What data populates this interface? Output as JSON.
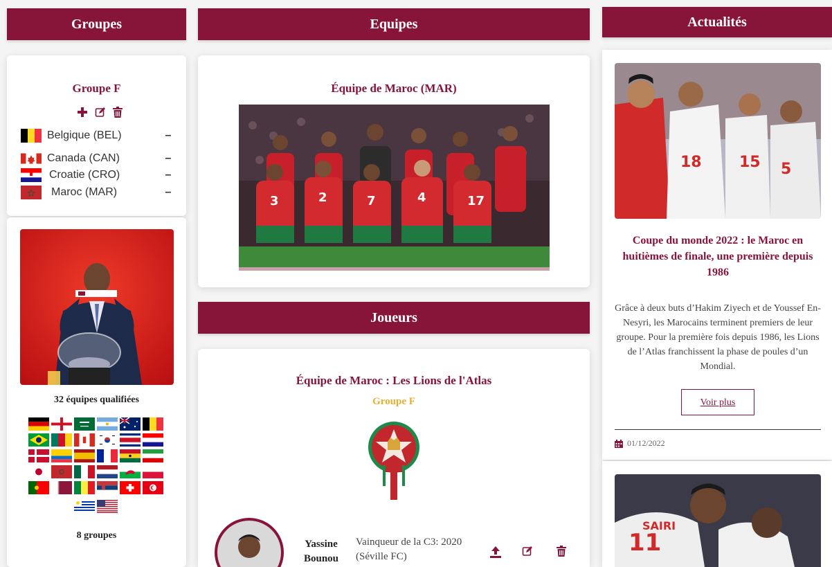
{
  "headers": {
    "groupes": "Groupes",
    "equipes": "Equipes",
    "actualites": "Actualités",
    "joueurs": "Joueurs"
  },
  "group_card": {
    "title": "Groupe F",
    "actions": [
      "add-icon",
      "edit-icon",
      "delete-icon"
    ],
    "teams": [
      {
        "name": "Belgique (BEL)",
        "value": "–"
      },
      {
        "name": "Canada (CAN)",
        "value": "–"
      },
      {
        "name": "Croatie (CRO)",
        "value": "–"
      },
      {
        "name": "Maroc (MAR)",
        "value": "–"
      }
    ]
  },
  "qualified_card": {
    "image": "draw-ceremony-photo",
    "qualified_label": "32 équipes qualifiées",
    "groups_label": "8 groupes"
  },
  "team_card": {
    "title": "Équipe de Maroc (MAR)",
    "image": "morocco-team-photo"
  },
  "players_card": {
    "title": "Équipe de Maroc : Les Lions de l'Atlas",
    "group": "Groupe F",
    "crest": "frmf-crest",
    "player": {
      "first_name": "Yassine",
      "last_name": "Bounou",
      "achievement_line1": "Vainqueur de la C3: 2020",
      "achievement_line2": "(Séville FC)"
    }
  },
  "news_card": {
    "image": "morocco-celebration-photo",
    "title": "Coupe du monde 2022 : le Maroc en huitièmes de finale, une première depuis 1986",
    "body": "Grâce à deux buts d’Hakim Ziyech et de Youssef En-Nesyri, les Marocains terminent premiers de leur groupe. Pour la première fois depuis 1986, les Lions de l’Atlas franchissent la phase de poules d’un Mondial.",
    "button": "Voir plus",
    "date": "01/12/2022"
  },
  "colors": {
    "accent": "#871539",
    "group_gold": "#e8b030"
  }
}
